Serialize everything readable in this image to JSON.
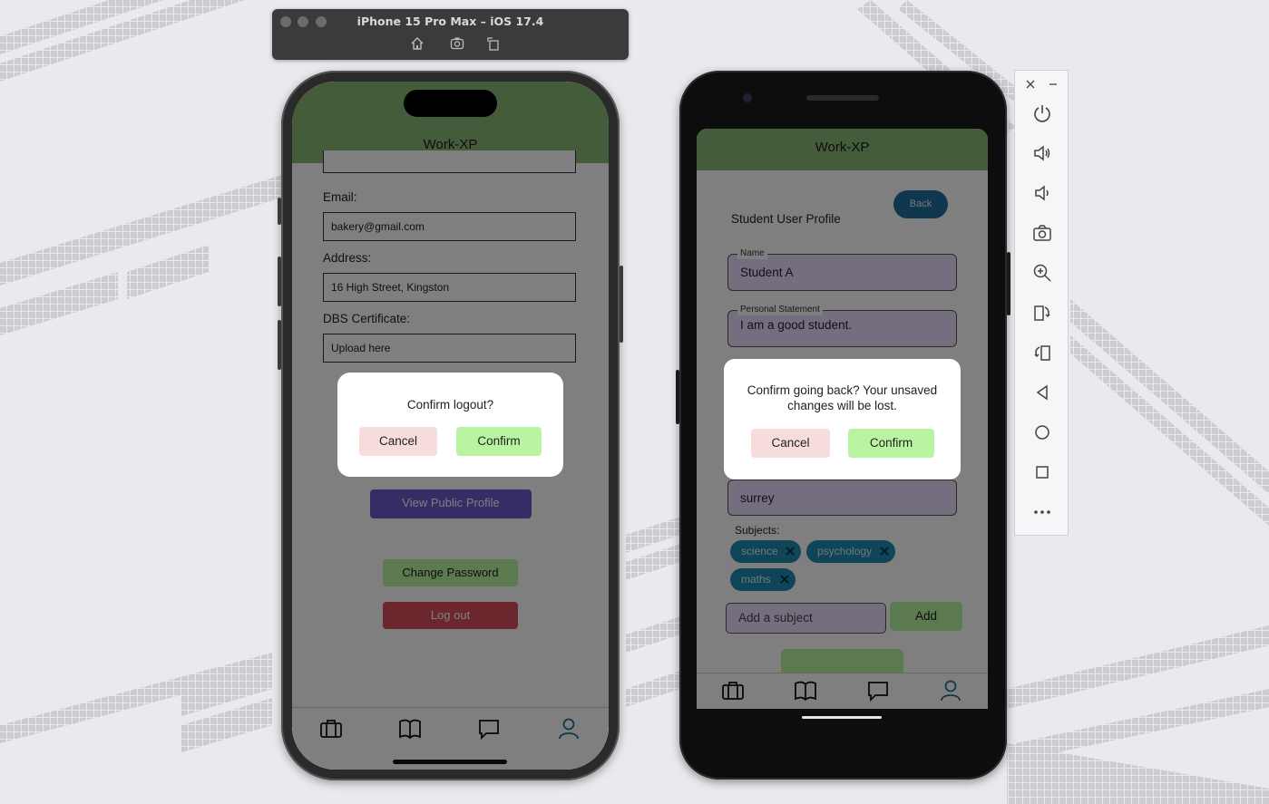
{
  "simulator": {
    "title": "iPhone 15 Pro Max – iOS 17.4",
    "toolbar_icons": [
      "home-icon",
      "screenshot-icon",
      "rotate-icon"
    ]
  },
  "ios_app": {
    "title": "Work-XP",
    "email_label": "Email:",
    "email_value": "bakery@gmail.com",
    "address_label": "Address:",
    "address_value": "16 High Street, Kingston",
    "dbs_label": "DBS Certificate:",
    "dbs_value": "Upload here",
    "view_public_profile": "View Public Profile",
    "change_password": "Change Password",
    "log_out": "Log out",
    "modal": {
      "message": "Confirm logout?",
      "cancel": "Cancel",
      "confirm": "Confirm"
    },
    "tabs": [
      "briefcase-icon",
      "book-icon",
      "chat-icon",
      "profile-icon"
    ]
  },
  "android_app": {
    "title": "Work-XP",
    "back_button": "Back",
    "page_heading": "Student User Profile",
    "name_label": "Name",
    "name_value": "Student A",
    "statement_label": "Personal Statement",
    "statement_value": "I am a good student.",
    "county_value": "surrey",
    "subjects_label": "Subjects:",
    "subjects": [
      "science",
      "psychology",
      "maths"
    ],
    "add_subject_placeholder": "Add a subject",
    "add_button": "Add",
    "modal": {
      "message": "Confirm going back? Your unsaved changes will be lost.",
      "cancel": "Cancel",
      "confirm": "Confirm"
    },
    "tabs": [
      "briefcase-icon",
      "book-icon",
      "chat-icon",
      "profile-icon"
    ]
  },
  "emulator_toolbar": {
    "items": [
      "close-icon",
      "minimize-icon",
      "power-icon",
      "volume-up-icon",
      "volume-down-icon",
      "camera-icon",
      "zoom-icon",
      "rotate-left-icon",
      "rotate-right-icon",
      "back-icon",
      "home-icon",
      "overview-icon",
      "more-icon"
    ]
  },
  "colors": {
    "header_green": "#8bb876",
    "confirm_green": "#b9f5a0",
    "cancel_pink": "#f7dcdc",
    "view_profile_purple": "#6a5acd",
    "logout_red": "#d94f5c",
    "chip_blue": "#1f8bb0",
    "active_tab_blue": "#1f6f9b"
  }
}
